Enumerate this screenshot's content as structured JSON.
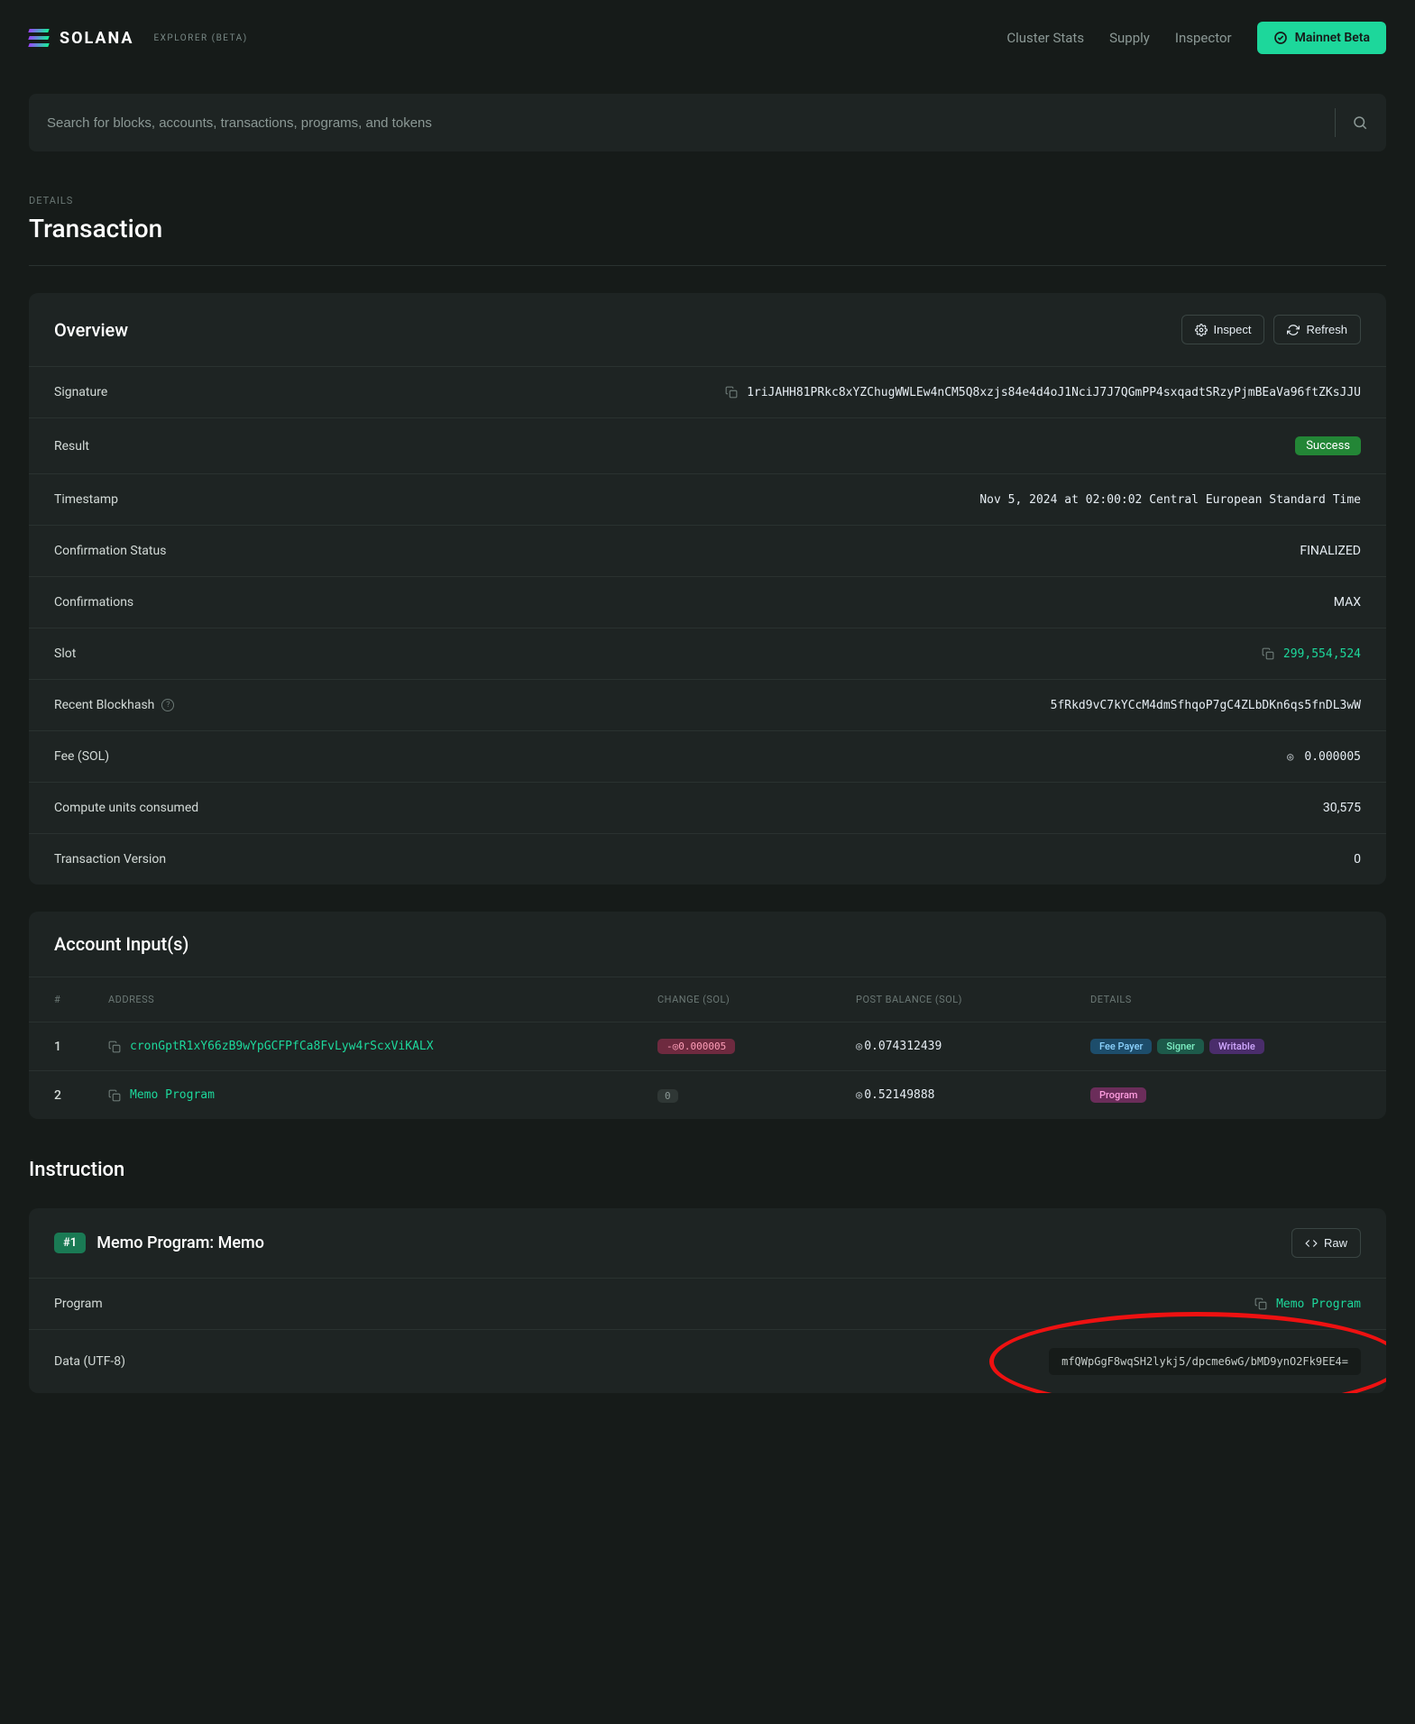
{
  "header": {
    "brand": "SOLANA",
    "brand_sub": "EXPLORER (BETA)",
    "nav": [
      "Cluster Stats",
      "Supply",
      "Inspector"
    ],
    "cluster_btn": "Mainnet Beta"
  },
  "search": {
    "placeholder": "Search for blocks, accounts, transactions, programs, and tokens"
  },
  "page": {
    "details_label": "DETAILS",
    "title": "Transaction"
  },
  "overview": {
    "title": "Overview",
    "inspect_btn": "Inspect",
    "refresh_btn": "Refresh",
    "rows": {
      "signature_label": "Signature",
      "signature_value": "1riJAHH81PRkc8xYZChugWWLEw4nCM5Q8xzjs84e4d4oJ1NciJ7J7QGmPP4sxqadtSRzyPjmBEaVa96ftZKsJJU",
      "result_label": "Result",
      "result_value": "Success",
      "timestamp_label": "Timestamp",
      "timestamp_value": "Nov 5, 2024 at 02:00:02 Central European Standard Time",
      "confirmation_status_label": "Confirmation Status",
      "confirmation_status_value": "FINALIZED",
      "confirmations_label": "Confirmations",
      "confirmations_value": "MAX",
      "slot_label": "Slot",
      "slot_value": "299,554,524",
      "blockhash_label": "Recent Blockhash",
      "blockhash_value": "5fRkd9vC7kYCcM4dmSfhqoP7gC4ZLbDKn6qs5fnDL3wW",
      "fee_label": "Fee (SOL)",
      "fee_value": "0.000005",
      "compute_label": "Compute units consumed",
      "compute_value": "30,575",
      "version_label": "Transaction Version",
      "version_value": "0"
    }
  },
  "accounts": {
    "title": "Account Input(s)",
    "headers": {
      "idx": "#",
      "address": "ADDRESS",
      "change": "CHANGE (SOL)",
      "post": "POST BALANCE (SOL)",
      "details": "DETAILS"
    },
    "rows": [
      {
        "idx": "1",
        "address": "cronGptR1xY66zB9wYpGCFPfCa8FvLyw4rScxViKALX",
        "change": "-◎0.000005",
        "post": "0.074312439",
        "tags": [
          "Fee Payer",
          "Signer",
          "Writable"
        ]
      },
      {
        "idx": "2",
        "address": "Memo Program",
        "change": "0",
        "post": "0.52149888",
        "tags": [
          "Program"
        ]
      }
    ]
  },
  "instruction": {
    "section_title": "Instruction",
    "badge": "#1",
    "title": "Memo Program: Memo",
    "raw_btn": "Raw",
    "program_label": "Program",
    "program_value": "Memo Program",
    "data_label": "Data (UTF-8)",
    "data_value": "mfQWpGgF8wqSH2lykj5/dpcme6wG/bMD9ynO2Fk9EE4="
  }
}
